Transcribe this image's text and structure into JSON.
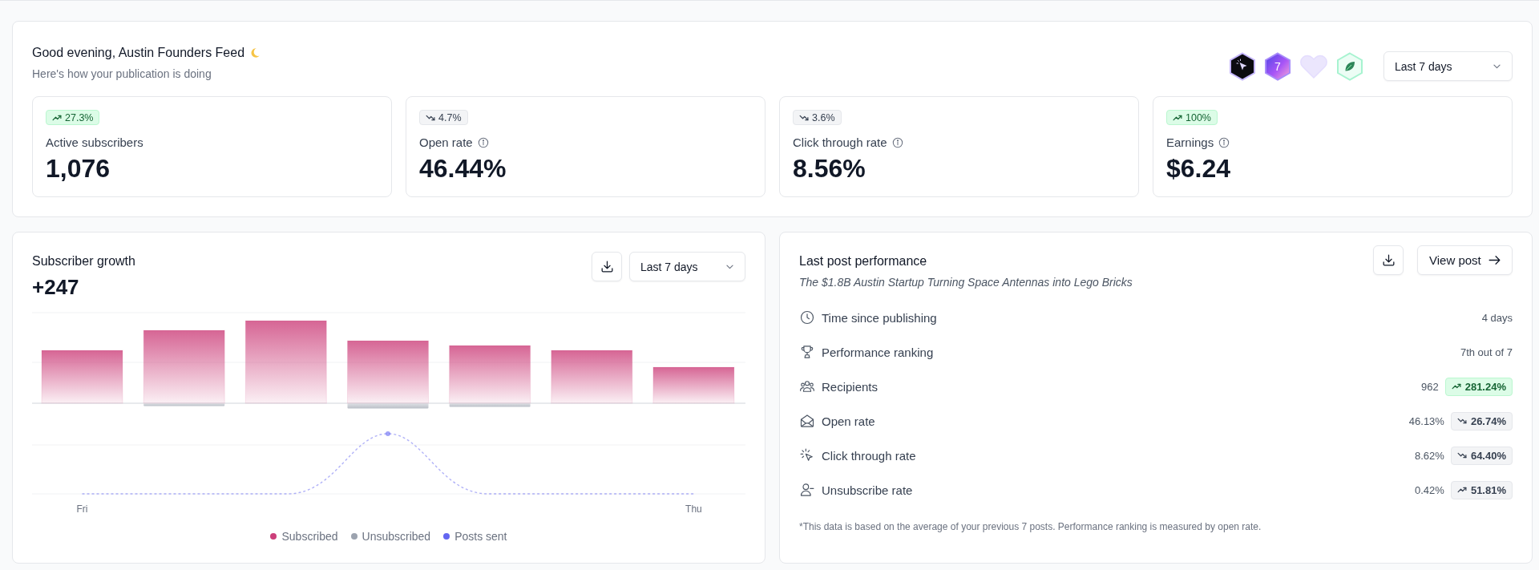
{
  "header": {
    "greeting": "Good evening, Austin Founders Feed",
    "subtitle": "Here's how your publication is doing",
    "achievements": [
      {
        "kind": "dark",
        "locked": false
      },
      {
        "kind": "violet",
        "label": "7",
        "locked": false
      },
      {
        "kind": "heart",
        "locked": true
      },
      {
        "kind": "mint",
        "locked": false
      }
    ],
    "range": {
      "value": "Last 7 days"
    }
  },
  "stats": [
    {
      "change": "27.3%",
      "rising": true,
      "positive": true,
      "label": "Active subscribers",
      "info": false,
      "value": "1,076"
    },
    {
      "change": "4.7%",
      "rising": false,
      "positive": false,
      "label": "Open rate",
      "info": true,
      "value": "46.44%"
    },
    {
      "change": "3.6%",
      "rising": false,
      "positive": false,
      "label": "Click through rate",
      "info": true,
      "value": "8.56%"
    },
    {
      "change": "100%",
      "rising": true,
      "positive": true,
      "label": "Earnings",
      "info": true,
      "value": "$6.24"
    }
  ],
  "growth": {
    "title": "Subscriber growth",
    "total": "+247",
    "range": {
      "value": "Last 7 days"
    },
    "x_labels": [
      "Fri",
      "Thu"
    ],
    "legend": [
      {
        "label": "Subscribed",
        "color": "#cc3f7a"
      },
      {
        "label": "Unsubscribed",
        "color": "#9ca3af"
      },
      {
        "label": "Posts sent",
        "color": "#6366f1"
      }
    ]
  },
  "last_post": {
    "title": "Last post performance",
    "post_title": "The $1.8B Austin Startup Turning Space Antennas into Lego Bricks",
    "view_button": "View post",
    "rows": [
      {
        "label": "Time since publishing",
        "value": "4 days"
      },
      {
        "label": "Performance ranking",
        "value": "7th out of 7"
      },
      {
        "label": "Recipients",
        "value": "962",
        "change": "281.24%",
        "rising": true,
        "positive": true
      },
      {
        "label": "Open rate",
        "value": "46.13%",
        "change": "26.74%",
        "rising": false,
        "positive": false
      },
      {
        "label": "Click through rate",
        "value": "8.62%",
        "change": "64.40%",
        "rising": false,
        "positive": false
      },
      {
        "label": "Unsubscribe rate",
        "value": "0.42%",
        "change": "51.81%",
        "rising": true,
        "positive": false
      }
    ],
    "footnote": "*This data is based on the average of your previous 7 posts. Performance ranking is measured by open rate."
  }
}
